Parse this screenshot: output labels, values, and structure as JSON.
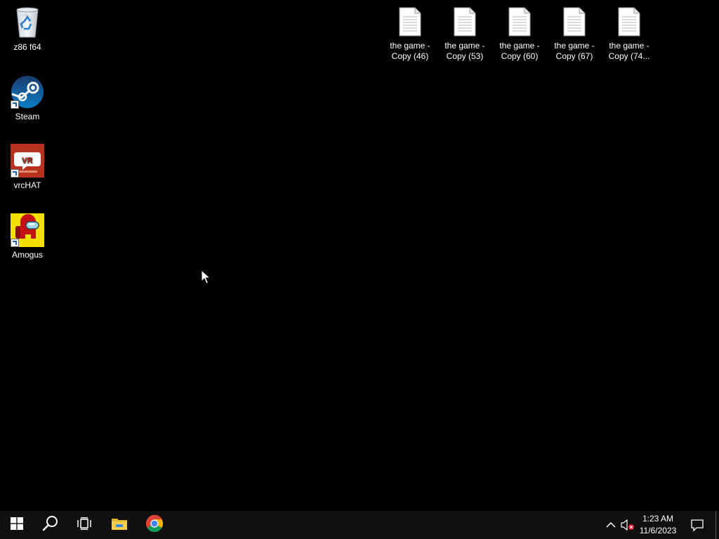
{
  "desktop": {
    "left_icons": [
      {
        "label": "z86 f64",
        "icon": "recycle-bin-icon"
      },
      {
        "label": "Steam",
        "icon": "steam-icon"
      },
      {
        "label": "vrcHAT",
        "icon": "vrchat-icon"
      },
      {
        "label": "Amogus",
        "icon": "among-us-icon"
      }
    ],
    "file_icons": [
      {
        "line1": "the game -",
        "line2": "Copy (46)"
      },
      {
        "line1": "the game -",
        "line2": "Copy (53)"
      },
      {
        "line1": "the game -",
        "line2": "Copy (60)"
      },
      {
        "line1": "the game -",
        "line2": "Copy (67)"
      },
      {
        "line1": "the game -",
        "line2": "Copy (74..."
      }
    ]
  },
  "taskbar": {
    "time": "1:23 AM",
    "date": "11/6/2023",
    "pinned": [
      "start-icon",
      "search-icon",
      "task-view-icon",
      "file-explorer-icon",
      "chrome-icon"
    ]
  },
  "colors": {
    "desktop_bg": "#000000",
    "taskbar_bg": "#101010",
    "windows_blue": "#ffffff",
    "steam_blue": "#1b2838",
    "vrchat_red": "#b8321f",
    "amogus_red": "#c51111",
    "amogus_bg": "#f5e000"
  }
}
